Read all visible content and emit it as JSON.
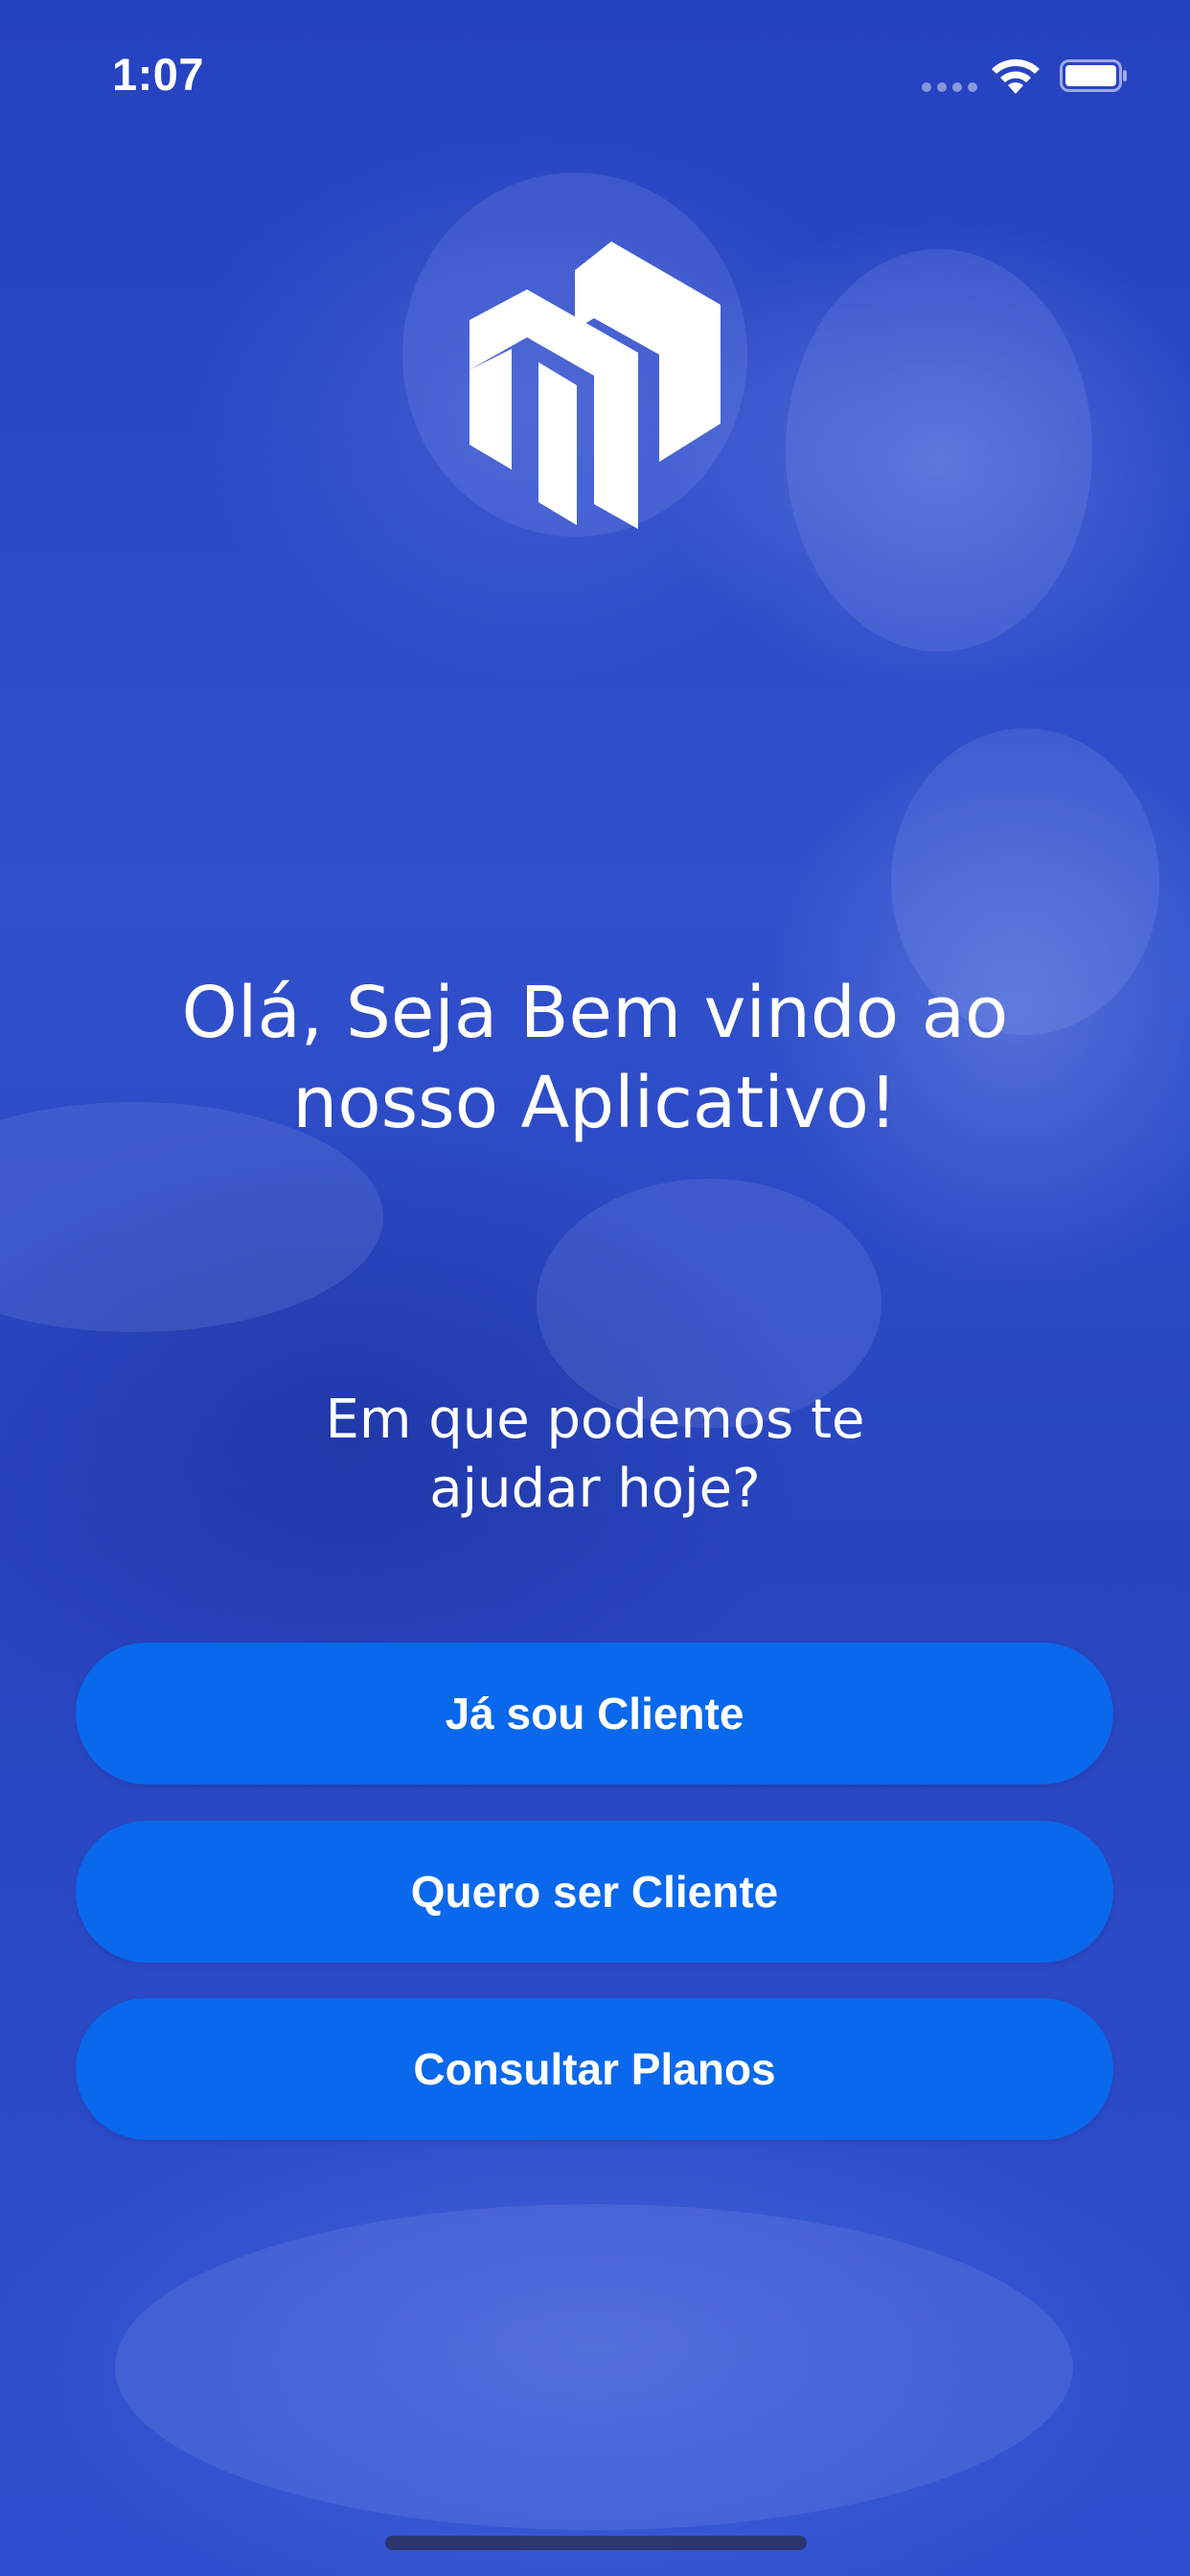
{
  "status_bar": {
    "time": "1:07",
    "icons": [
      "signal-dots-icon",
      "wifi-icon",
      "battery-icon"
    ]
  },
  "logo": {
    "icon": "brand-logo-icon",
    "color": "#ffffff"
  },
  "welcome": {
    "line1": "Olá, Seja Bem vindo ao",
    "line2": "nosso Aplicativo!"
  },
  "prompt": {
    "line1": "Em que podemos te",
    "line2": "ajudar hoje?"
  },
  "buttons": {
    "already_client": "Já sou Cliente",
    "want_client": "Quero ser Cliente",
    "check_plans": "Consultar Planos"
  },
  "colors": {
    "background": "#2a46c4",
    "button": "#0a68ec",
    "text": "#ffffff"
  }
}
